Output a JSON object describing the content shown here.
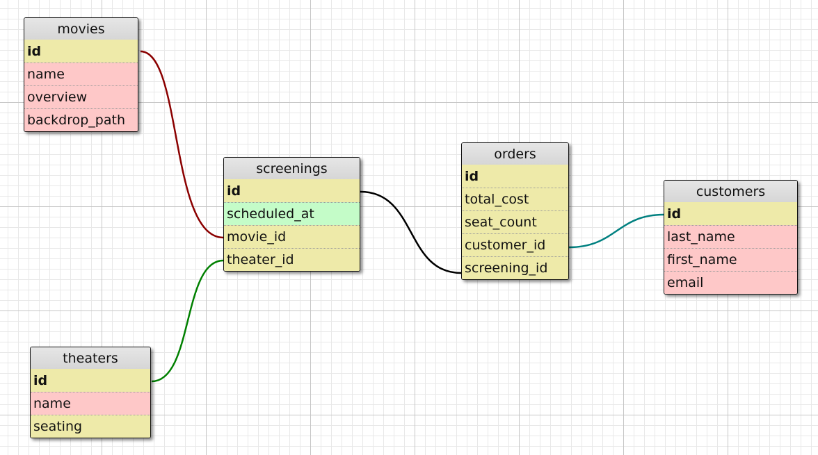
{
  "tables": {
    "movies": {
      "title": "movies",
      "fields": [
        {
          "label": "id",
          "kind": "pk"
        },
        {
          "label": "name",
          "kind": "plain"
        },
        {
          "label": "overview",
          "kind": "plain"
        },
        {
          "label": "backdrop_path",
          "kind": "plain"
        }
      ]
    },
    "screenings": {
      "title": "screenings",
      "fields": [
        {
          "label": "id",
          "kind": "pk"
        },
        {
          "label": "scheduled_at",
          "kind": "time"
        },
        {
          "label": "movie_id",
          "kind": "key"
        },
        {
          "label": "theater_id",
          "kind": "key"
        }
      ]
    },
    "theaters": {
      "title": "theaters",
      "fields": [
        {
          "label": "id",
          "kind": "pk"
        },
        {
          "label": "name",
          "kind": "plain"
        },
        {
          "label": "seating",
          "kind": "key"
        }
      ]
    },
    "orders": {
      "title": "orders",
      "fields": [
        {
          "label": "id",
          "kind": "pk"
        },
        {
          "label": "total_cost",
          "kind": "key"
        },
        {
          "label": "seat_count",
          "kind": "key"
        },
        {
          "label": "customer_id",
          "kind": "key"
        },
        {
          "label": "screening_id",
          "kind": "key"
        }
      ]
    },
    "customers": {
      "title": "customers",
      "fields": [
        {
          "label": "id",
          "kind": "pk"
        },
        {
          "label": "last_name",
          "kind": "plain"
        },
        {
          "label": "first_name",
          "kind": "plain"
        },
        {
          "label": "email",
          "kind": "plain"
        }
      ]
    }
  },
  "relations": [
    {
      "from": "movies.id",
      "to": "screenings.movie_id",
      "color": "#8b0000"
    },
    {
      "from": "theaters.id",
      "to": "screenings.theater_id",
      "color": "#008000"
    },
    {
      "from": "screenings.id",
      "to": "orders.screening_id",
      "color": "#000000"
    },
    {
      "from": "orders.customer_id",
      "to": "customers.id",
      "color": "#008080"
    }
  ]
}
